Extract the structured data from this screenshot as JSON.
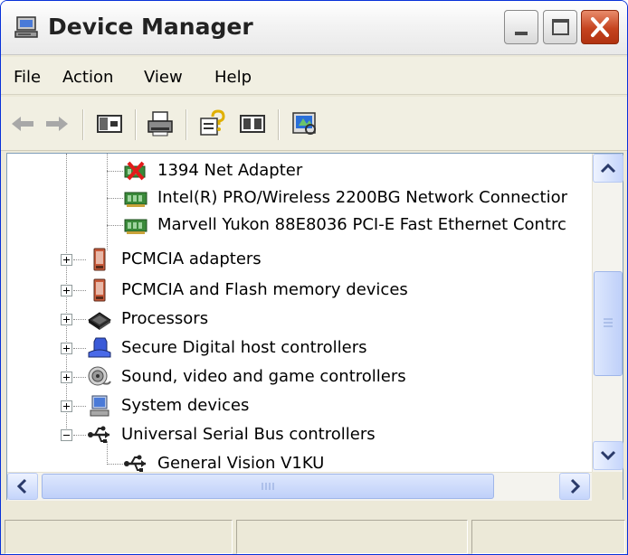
{
  "window": {
    "title": "Device Manager",
    "buttons": {
      "minimize": "minimize-icon",
      "maximize": "maximize-icon",
      "close": "close-icon"
    }
  },
  "menu": [
    "File",
    "Action",
    "View",
    "Help"
  ],
  "toolbar": {
    "icons": [
      "back-arrow-icon",
      "forward-arrow-icon",
      "show-hide-console-tree-icon",
      "print-icon",
      "help-icon",
      "properties-icon",
      "scan-hardware-icon"
    ]
  },
  "tree": {
    "items": [
      {
        "label": "1394 Net Adapter",
        "icon": "network-adapter-disabled-icon"
      },
      {
        "label": "Intel(R) PRO/Wireless 2200BG Network Connectior",
        "icon": "network-adapter-icon"
      },
      {
        "label": "Marvell Yukon 88E8036 PCI-E Fast Ethernet Contrc",
        "icon": "network-adapter-icon"
      },
      {
        "label": "PCMCIA adapters",
        "icon": "pcmcia-icon",
        "expander": "+"
      },
      {
        "label": "PCMCIA and Flash memory devices",
        "icon": "pcmcia-icon",
        "expander": "+"
      },
      {
        "label": "Processors",
        "icon": "processor-icon",
        "expander": "+"
      },
      {
        "label": "Secure Digital host controllers",
        "icon": "sd-controller-icon",
        "expander": "+"
      },
      {
        "label": "Sound, video and game controllers",
        "icon": "sound-icon",
        "expander": "+"
      },
      {
        "label": "System devices",
        "icon": "system-devices-icon",
        "expander": "+"
      },
      {
        "label": "Universal Serial Bus controllers",
        "icon": "usb-icon",
        "expander": "-"
      },
      {
        "label": "General Vision V1KU",
        "icon": "usb-icon"
      }
    ]
  },
  "colors": {
    "window_border": "#0831d9",
    "close_button": "#c5431f",
    "panel_border": "#7f9db9",
    "scrollbar": "#c5d5fb"
  }
}
